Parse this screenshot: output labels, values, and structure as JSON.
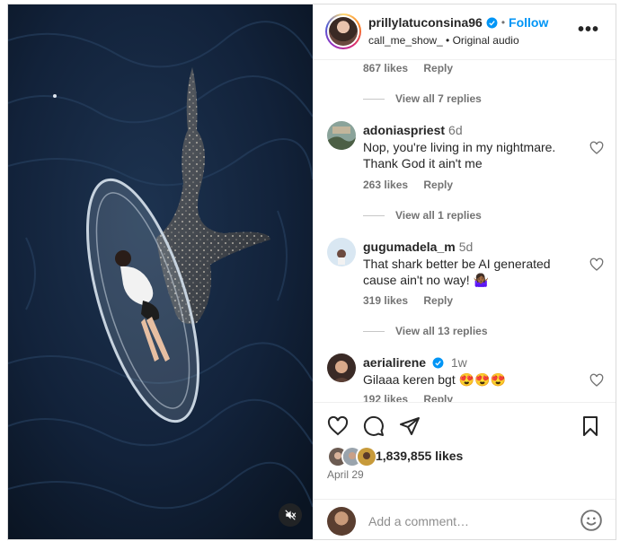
{
  "post": {
    "username": "prillylatuconsina96",
    "dot": "•",
    "follow_label": "Follow",
    "audio": "call_me_show_ • Original audio",
    "more": "•••"
  },
  "comments_area": {
    "top_meta": {
      "likes": "867 likes",
      "reply": "Reply"
    },
    "replies_1": "View all 7 replies",
    "items": [
      {
        "username": "adoniaspriest",
        "time": "6d",
        "text": "Nop, you're living in my nightmare. Thank God it ain't me",
        "likes": "263 likes",
        "reply": "Reply",
        "replies": "View all 1 replies"
      },
      {
        "username": "gugumadela_m",
        "time": "5d",
        "text": "That shark better be AI generated cause ain't no way! 🤷🏾‍♀️",
        "likes": "319 likes",
        "reply": "Reply",
        "replies": "View all 13 replies"
      },
      {
        "username": "aerialirene",
        "time": "1w",
        "text": "Gilaaa keren bgt 😍😍😍",
        "likes": "192 likes",
        "reply": "Reply"
      }
    ]
  },
  "footer": {
    "likes_count": "1,839,855 likes",
    "date": "April 29",
    "comment_placeholder": "Add a comment…"
  },
  "colors": {
    "accent": "#0095f6",
    "ocean": "#0f1b2b",
    "text": "#262626",
    "muted": "#737373"
  }
}
